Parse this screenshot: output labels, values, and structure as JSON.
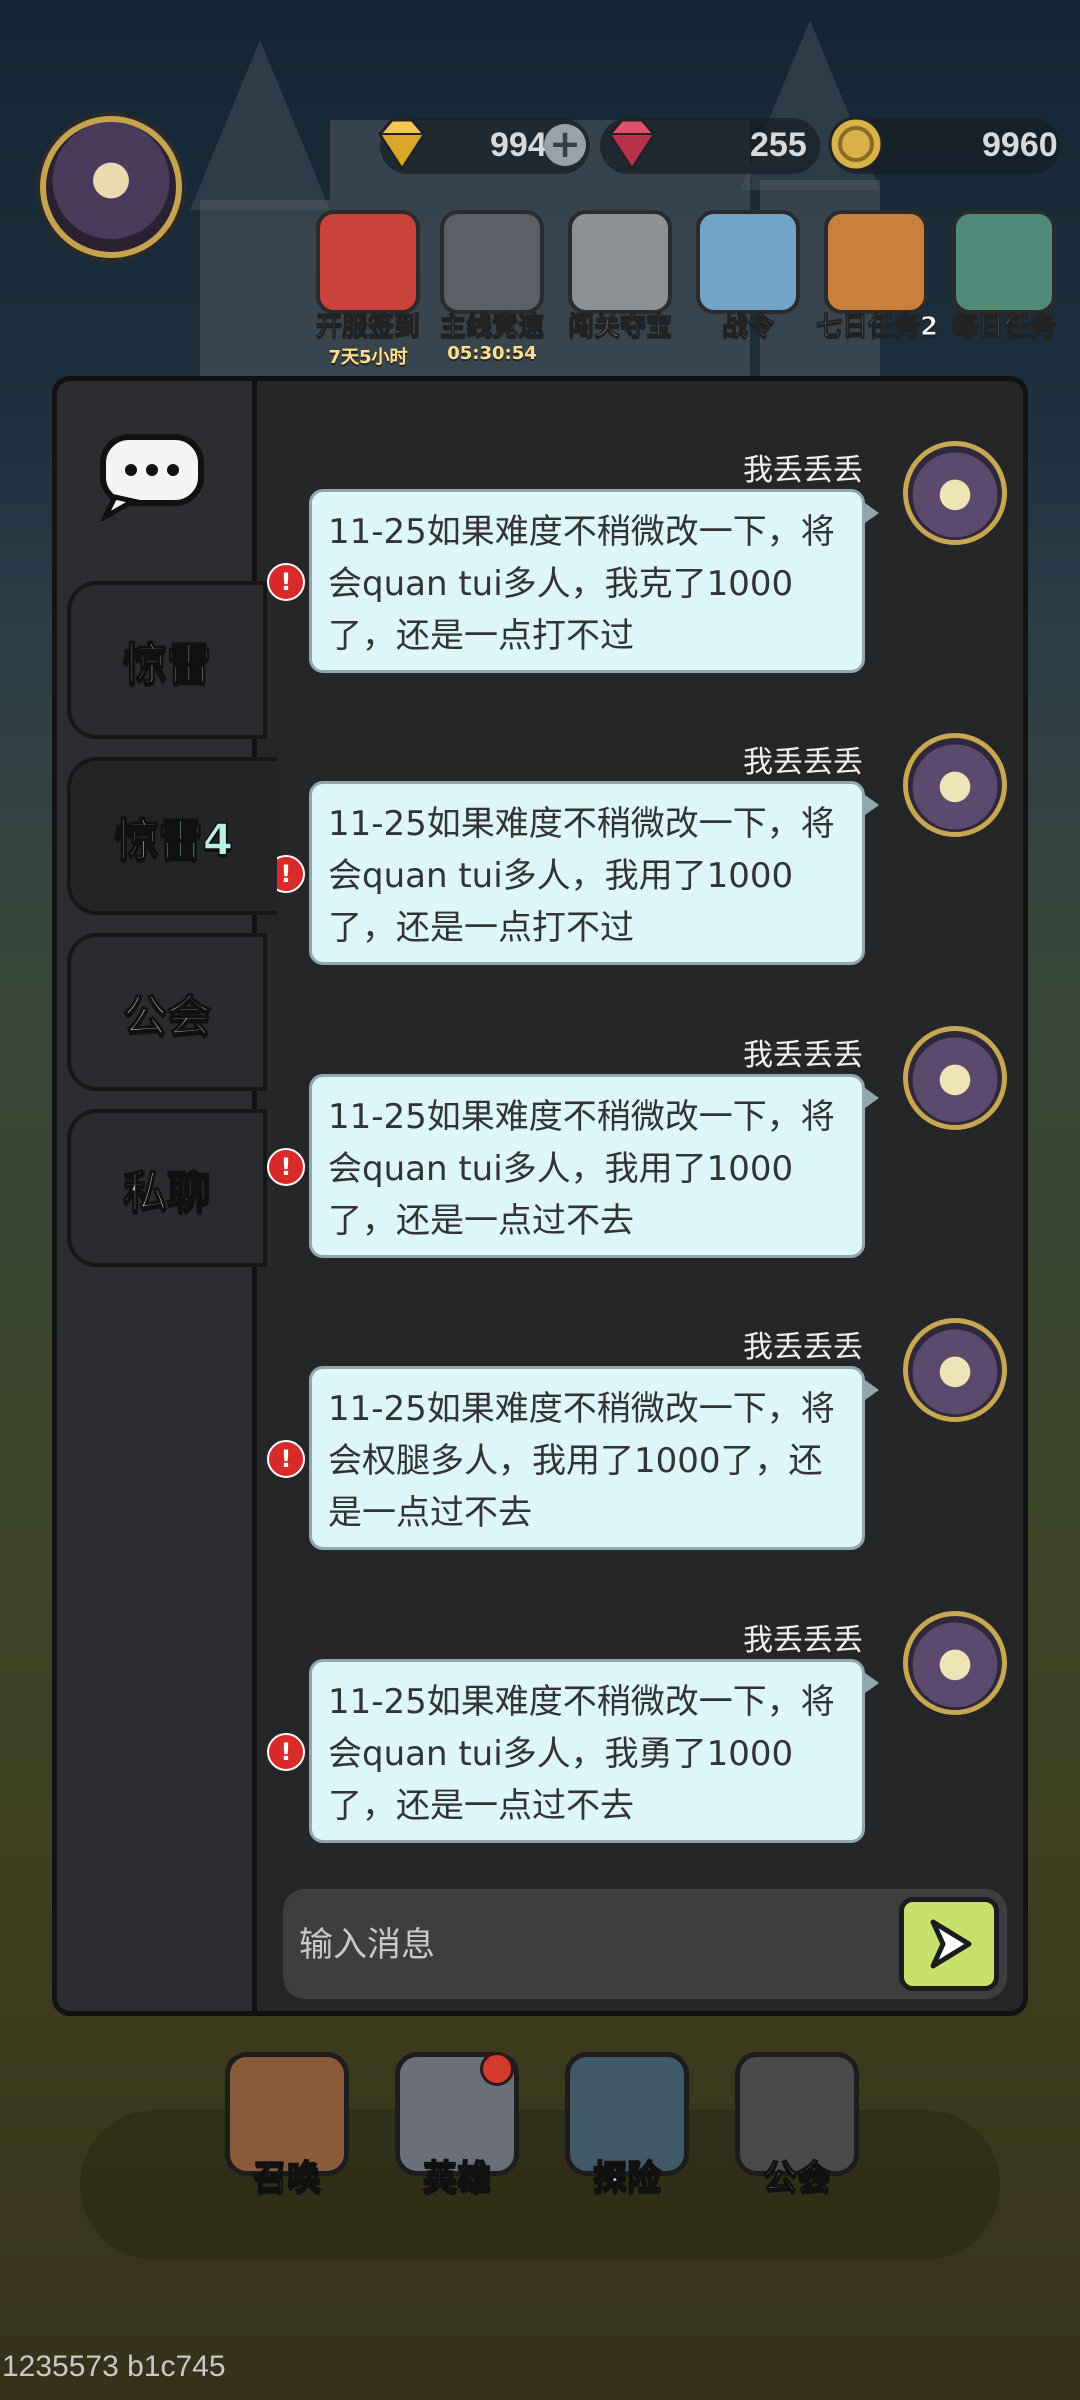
{
  "hud": {
    "currency": [
      {
        "name": "gold-gem",
        "value": "994"
      },
      {
        "name": "red-gem",
        "value": "255"
      },
      {
        "name": "coin",
        "value": "9960"
      }
    ],
    "top_menu": [
      {
        "label": "开服签到",
        "sub": "7天5小时",
        "icon": "calendar-icon"
      },
      {
        "label": "主线竞速",
        "sub": "05:30:54",
        "icon": "trophy-icon"
      },
      {
        "label": "闯关夺宝",
        "sub": "",
        "icon": "dragon-icon"
      },
      {
        "label": "战令",
        "sub": "",
        "icon": "banner-icon"
      },
      {
        "label": "七日任务2",
        "sub": "",
        "icon": "helmet-icon"
      },
      {
        "label": "每日任务",
        "sub": "",
        "icon": "book-icon"
      }
    ]
  },
  "chat": {
    "tabs": [
      {
        "label": "惊雷",
        "active": false
      },
      {
        "label": "惊雷4",
        "active": true
      },
      {
        "label": "公会",
        "active": false
      },
      {
        "label": "私聊",
        "active": false
      }
    ],
    "messages": [
      {
        "sender": "我丢丢丢",
        "text": "11-25如果难度不稍微改一下，将会quan tui多人，我克了1000了，还是一点打不过"
      },
      {
        "sender": "我丢丢丢",
        "text": "11-25如果难度不稍微改一下，将会quan tui多人，我用了1000了，还是一点打不过"
      },
      {
        "sender": "我丢丢丢",
        "text": "11-25如果难度不稍微改一下，将会quan tui多人，我用了1000了，还是一点过不去"
      },
      {
        "sender": "我丢丢丢",
        "text": "11-25如果难度不稍微改一下，将会权腿多人，我用了1000了，还是一点过不去"
      },
      {
        "sender": "我丢丢丢",
        "text": "11-25如果难度不稍微改一下，将会quan tui多人，我勇了1000了，还是一点过不去"
      }
    ],
    "input_placeholder": "输入消息"
  },
  "bottom_nav": [
    {
      "label": "召唤",
      "icon": "summon-helmet-icon",
      "color": "#8a5a3a"
    },
    {
      "label": "英雄",
      "icon": "hero-crest-icon",
      "color": "#6a6f7a"
    },
    {
      "label": "探险",
      "icon": "compass-icon",
      "color": "#3f5a66"
    },
    {
      "label": "公会",
      "icon": "guild-shield-icon",
      "color": "#4a4a4a"
    }
  ],
  "version": "1235573 b1c745"
}
